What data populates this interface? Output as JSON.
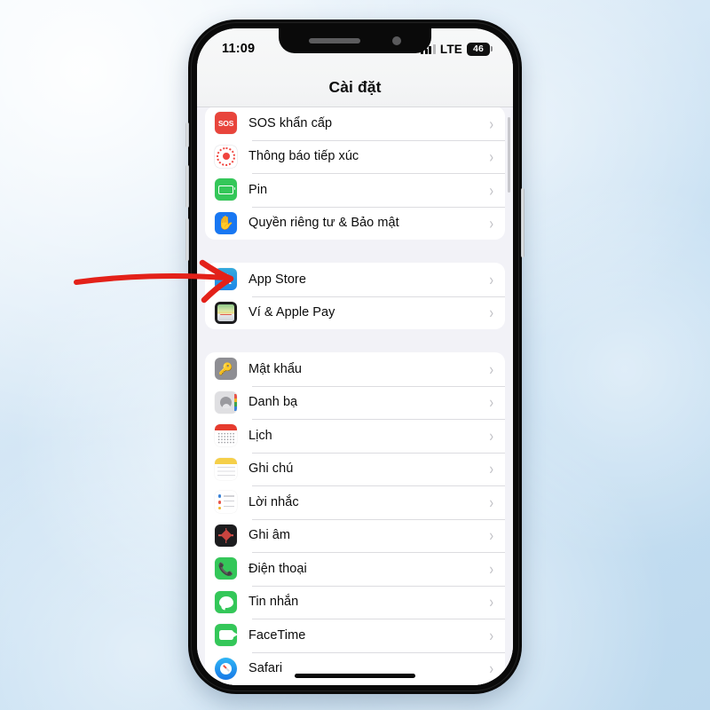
{
  "status_bar": {
    "time": "11:09",
    "network": "LTE",
    "battery": "46",
    "signal_icon": "cellular-signal-icon"
  },
  "nav": {
    "title": "Cài đặt"
  },
  "chevron": "›",
  "sections": [
    {
      "id": "section-system",
      "rows": [
        {
          "label": "SOS khẩn cấp",
          "icon": "sos-icon",
          "icon_class": "i-sos",
          "glyph": "SOS"
        },
        {
          "label": "Thông báo tiếp xúc",
          "icon": "exposure-notification-icon",
          "icon_class": "i-exposure",
          "glyph": ""
        },
        {
          "label": "Pin",
          "icon": "battery-icon",
          "icon_class": "i-battery",
          "glyph": ""
        },
        {
          "label": "Quyền riêng tư & Bảo mật",
          "icon": "privacy-hand-icon",
          "icon_class": "i-privacy",
          "glyph": "✋"
        }
      ]
    },
    {
      "id": "section-store",
      "rows": [
        {
          "label": "App Store",
          "icon": "app-store-icon",
          "icon_class": "i-appstore",
          "glyph": "A"
        },
        {
          "label": "Ví & Apple Pay",
          "icon": "wallet-icon",
          "icon_class": "i-wallet",
          "glyph": ""
        }
      ]
    },
    {
      "id": "section-apps",
      "rows": [
        {
          "label": "Mật khẩu",
          "icon": "passwords-key-icon",
          "icon_class": "i-pwd",
          "glyph": "🔑"
        },
        {
          "label": "Danh bạ",
          "icon": "contacts-icon",
          "icon_class": "i-contacts",
          "glyph": ""
        },
        {
          "label": "Lịch",
          "icon": "calendar-icon",
          "icon_class": "i-cal",
          "glyph": ""
        },
        {
          "label": "Ghi chú",
          "icon": "notes-icon",
          "icon_class": "i-notes",
          "glyph": ""
        },
        {
          "label": "Lời nhắc",
          "icon": "reminders-icon",
          "icon_class": "i-rem",
          "glyph": ""
        },
        {
          "label": "Ghi âm",
          "icon": "voice-memos-icon",
          "icon_class": "i-voice",
          "glyph": ""
        },
        {
          "label": "Điện thoại",
          "icon": "phone-icon",
          "icon_class": "i-phone",
          "glyph": "📞"
        },
        {
          "label": "Tin nhắn",
          "icon": "messages-icon",
          "icon_class": "i-msg",
          "glyph": ""
        },
        {
          "label": "FaceTime",
          "icon": "facetime-icon",
          "icon_class": "i-ft",
          "glyph": ""
        },
        {
          "label": "Safari",
          "icon": "safari-icon",
          "icon_class": "i-safari",
          "glyph": ""
        }
      ]
    }
  ],
  "annotation": {
    "type": "red-arrow",
    "points_to": "App Store",
    "color": "#e32119"
  },
  "device": {
    "buttons": [
      "mute-switch",
      "volume-up-button",
      "volume-down-button",
      "power-button"
    ],
    "home_indicator": "home-indicator"
  },
  "colors": {
    "background_sky": "#c6dff2",
    "list_background": "#f2f2f7",
    "row_background": "#ffffff",
    "accent_red": "#e32119"
  }
}
